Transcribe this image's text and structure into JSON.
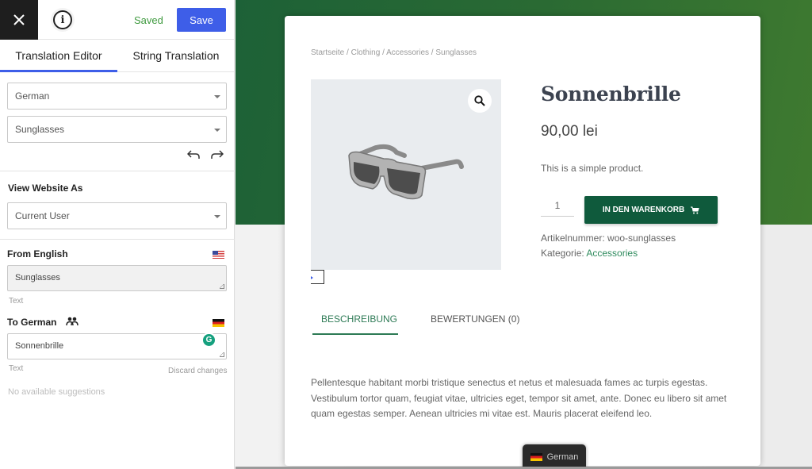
{
  "sidebar": {
    "topbar": {
      "close_icon": "close-icon",
      "info_icon": "info-icon",
      "status": "Saved",
      "save_label": "Save"
    },
    "tabs": [
      {
        "label": "Translation Editor",
        "active": true
      },
      {
        "label": "String Translation",
        "active": false
      }
    ],
    "language_select": {
      "value": "German"
    },
    "string_select": {
      "value": "Sunglasses"
    },
    "history": {
      "undo_icon": "undo-icon",
      "redo_icon": "redo-icon"
    },
    "view_as": {
      "title": "View Website As",
      "value": "Current User"
    },
    "source": {
      "title": "From English",
      "flag": "us-flag-icon",
      "value": "Sunglasses",
      "type_label": "Text"
    },
    "target": {
      "title": "To German",
      "flag": "german-flag-icon",
      "value": "Sonnenbrille",
      "type_label": "Text",
      "discard_label": "Discard changes"
    },
    "suggestions": "No available suggestions",
    "colors": {
      "accent": "#3e5ee8",
      "saved": "#3f9a3f"
    }
  },
  "preview": {
    "breadcrumb": [
      "Startseite",
      "Clothing",
      "Accessories",
      "Sunglasses"
    ],
    "breadcrumb_separator": " / ",
    "product": {
      "title": "Sonnenbrille",
      "price": "90,00 lei",
      "short_description": "This is a simple product.",
      "quantity": "1",
      "add_to_cart": "IN DEN WARENKORB",
      "sku_label": "Artikelnummer:",
      "sku": "woo-sunglasses",
      "category_label": "Kategorie:",
      "category": "Accessories"
    },
    "tabs": [
      {
        "label": "BESCHREIBUNG",
        "active": true
      },
      {
        "label": "BEWERTUNGEN (0)",
        "active": false
      }
    ],
    "description": "Pellentesque habitant morbi tristique senectus et netus et malesuada fames ac turpis egestas. Vestibulum tortor quam, feugiat vitae, ultricies eget, tempor sit amet, ante. Donec eu libero sit amet quam egestas semper. Aenean ultricies mi vitae est. Mauris placerat eleifend leo.",
    "language_switcher": "German",
    "colors": {
      "hero": "#1d6137",
      "button": "#0f5a3c",
      "link": "#2d8a5c"
    }
  }
}
